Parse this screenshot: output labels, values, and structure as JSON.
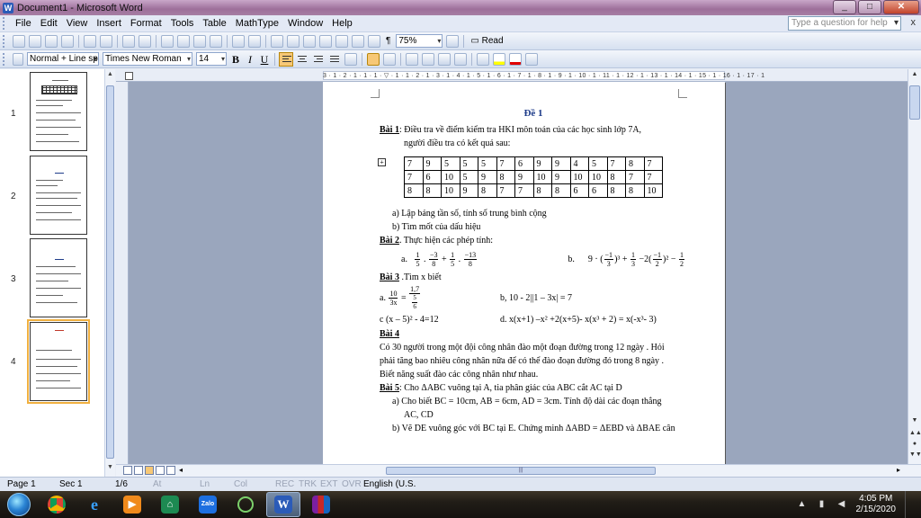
{
  "window": {
    "title": "Document1 - Microsoft Word",
    "minimize": "_",
    "maximize": "□",
    "close": "✕"
  },
  "menu": {
    "items": [
      "File",
      "Edit",
      "View",
      "Insert",
      "Format",
      "Tools",
      "Table",
      "MathType",
      "Window",
      "Help"
    ],
    "help_placeholder": "Type a question for help",
    "close_doc": "x"
  },
  "toolbar": {
    "zoom": "75%",
    "read_label": "Read"
  },
  "format": {
    "style": "Normal + Line sp",
    "font": "Times New Roman",
    "size": "14",
    "bold": "B",
    "italic": "I",
    "underline": "U"
  },
  "ruler": {
    "marks": "3 · 1 · 2 · 1 · 1 · 1 · ▽ · 1 · 1 · 2 · 1 · 3 · 1 · 4 · 1 · 5 · 1 · 6 · 1 · 7 · 1 · 8 · 1 · 9 · 1 · 10 · 1 · 11 · 1 · 12 · 1 · 13 · 1 · 14 · 1 · 15 · 1 · 16 · 1 · 17 · 1"
  },
  "thumbnails": {
    "pages": [
      "1",
      "2",
      "3",
      "4"
    ]
  },
  "document": {
    "heading": "Đề 1",
    "bai1_label": "Bài 1",
    "bai1_text": ": Điều tra về điểm kiểm tra HKI môn toán của các học sinh lớp 7A,",
    "bai1_text2": "người điều tra có kết quả sau:",
    "table": [
      [
        "7",
        "9",
        "5",
        "5",
        "5",
        "7",
        "6",
        "9",
        "9",
        "4",
        "5",
        "7",
        "8",
        "7"
      ],
      [
        "7",
        "6",
        "10",
        "5",
        "9",
        "8",
        "9",
        "10",
        "9",
        "10",
        "10",
        "8",
        "7",
        "7"
      ],
      [
        "8",
        "8",
        "10",
        "9",
        "8",
        "7",
        "7",
        "8",
        "8",
        "6",
        "6",
        "8",
        "8",
        "10"
      ]
    ],
    "bai1_a": "a)  Lập bảng tần số, tính số trung bình cộng",
    "bai1_b": "b)  Tìm mốt của dấu hiệu",
    "bai2_label": "Bài 2",
    "bai2_text": ". Thực hiện các  phép tính:",
    "bai2_a_label": "a.",
    "bai2_a_expr": {
      "f1n": "1",
      "f1d": "5",
      "op1": " . ",
      "f2n": "−3",
      "f2d": "8",
      "op2": " + ",
      "f3n": "1",
      "f3d": "5",
      "op3": " . ",
      "f4n": "−13",
      "f4d": "8"
    },
    "bai2_b_label": "b.",
    "bai2_b_expr": {
      "lead": "9 · (",
      "f1n": "−1",
      "f1d": "3",
      "exp1": ")³ + ",
      "f2n": "1",
      "f2d": "3",
      "mid": " −2(",
      "f3n": "−1",
      "f3d": "2",
      "exp2": ")² − ",
      "f4n": "1",
      "f4d": "2"
    },
    "bai3_label": "Bài 3",
    "bai3_text": " .Tìm x biết",
    "bai3_a_label": "a.",
    "bai3_a_f1n": "10",
    "bai3_a_f1d": "3x",
    "bai3_a_eq": " = ",
    "bai3_a_f2n": "1,7",
    "bai3_a_f2d_n": "5",
    "bai3_a_f2d_d": "6",
    "bai3_b": "b, 10 - 2||1 – 3x| = 7",
    "bai3_c": "c (x – 5)² - 4=12",
    "bai3_d": "d. x(x+1) –x² +2(x+5)- x(x³ + 2) = x(-x³- 3)",
    "bai4_label": "Bài 4",
    "bai4_l1": "Có 30 người trong một đội công nhân đào một đoạn đường trong 12 ngày . Hỏi",
    "bai4_l2": "phải tăng bao nhiêu công nhân nữa để có thể đào đoạn đường đó trong 8 ngày .",
    "bai4_l3": "Biết năng suất đào các công nhân như nhau.",
    "bai5_label": "Bài 5",
    "bai5_text": ": Cho ΔABC vuông tại A, tia phân giác của ABC cắt AC tại D",
    "bai5_a1": "a)  Cho biết BC = 10cm, AB = 6cm, AD = 3cm. Tính độ dài các đoạn thẳng",
    "bai5_a2": "AC, CD",
    "bai5_b": "b)  Vẽ DE vuông góc với BC tại E. Chứng minh ΔABD = ΔEBD và ΔBAE cân"
  },
  "status": {
    "page": "Page 1",
    "sec": "Sec 1",
    "pages": "1/6",
    "at": "At",
    "ln": "Ln",
    "col": "Col",
    "rec": "REC",
    "trk": "TRK",
    "ext": "EXT",
    "ovr": "OVR",
    "lang": "English (U.S."
  },
  "taskbar": {
    "apps": [
      "chrome",
      "edge",
      "media-player",
      "app-a",
      "zalo",
      "app-c",
      "word",
      "winrar"
    ],
    "zalo_label": "Zalo",
    "word_label": "W",
    "time": "4:05 PM",
    "date": "2/15/2020"
  }
}
